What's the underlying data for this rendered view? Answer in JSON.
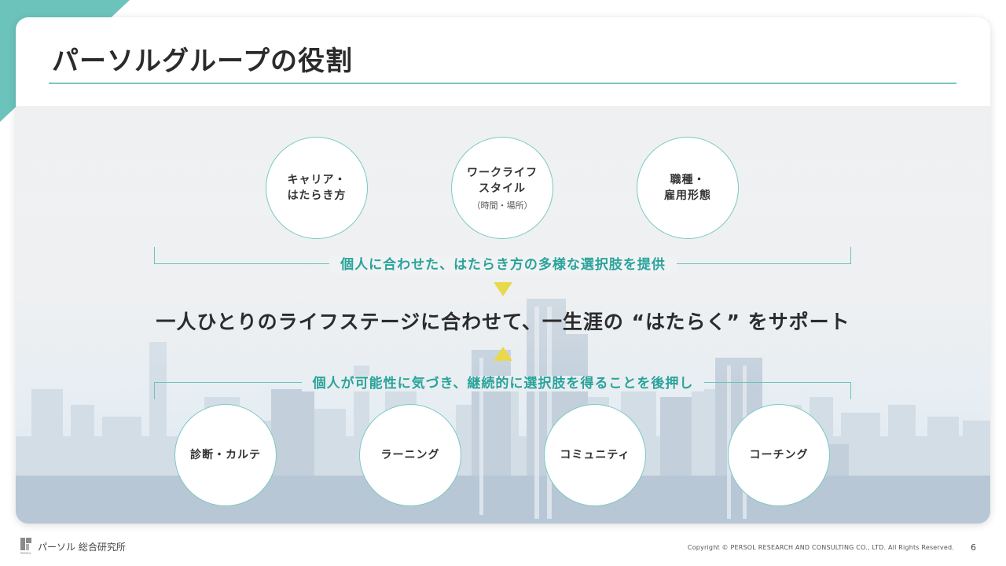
{
  "title": "パーソルグループの役割",
  "top_circles": [
    {
      "label": "キャリア・\nはたらき方",
      "sub": ""
    },
    {
      "label": "ワークライフ\nスタイル",
      "sub": "（時間・場所）"
    },
    {
      "label": "職種・\n雇用形態",
      "sub": ""
    }
  ],
  "caption_top": "個人に合わせた、はたらき方の多様な選択肢を提供",
  "headline": "一人ひとりのライフステージに合わせて、一生涯の “はたらく” をサポート",
  "caption_bottom": "個人が可能性に気づき、継続的に選択肢を得ることを後押し",
  "bottom_circles": [
    {
      "label": "診断・カルテ"
    },
    {
      "label": "ラーニング"
    },
    {
      "label": "コミュニティ"
    },
    {
      "label": "コーチング"
    }
  ],
  "footer": {
    "logo_text": "パーソル 総合研究所",
    "logo_small": "PERSOL",
    "copyright": "Copyright  © PERSOL RESEARCH AND CONSULTING CO., LTD. All Rights Reserved.",
    "page": "6"
  },
  "colors": {
    "accent": "#6cc3bc",
    "caption": "#2aa39a",
    "arrow": "#e9d94a"
  }
}
